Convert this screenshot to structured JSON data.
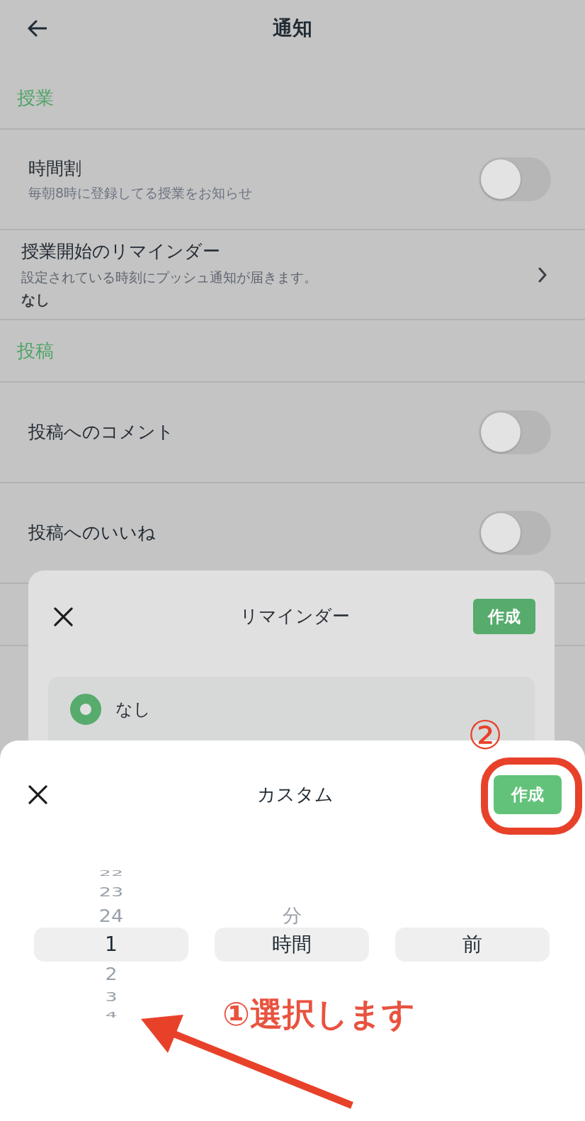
{
  "header": {
    "title": "通知"
  },
  "sections": [
    {
      "title": "授業",
      "rows": [
        {
          "kind": "toggle",
          "title": "時間割",
          "subtitle": "毎朝8時に登録してる授業をお知らせ",
          "on": false
        },
        {
          "kind": "link",
          "title": "授業開始のリマインダー",
          "subtitle": "設定されている時刻にプッシュ通知が届きます。",
          "value": "なし"
        }
      ]
    },
    {
      "title": "投稿",
      "rows": [
        {
          "kind": "toggle",
          "title": "投稿へのコメント",
          "on": false
        },
        {
          "kind": "toggle",
          "title": "投稿へのいいね",
          "on": false
        }
      ]
    }
  ],
  "reminder_dialog": {
    "title": "リマインダー",
    "action": "作成",
    "options": [
      {
        "label": "なし",
        "selected": true
      }
    ]
  },
  "custom_sheet": {
    "title": "カスタム",
    "action": "作成",
    "wheels": [
      {
        "items": [
          {
            "label": "22",
            "selected": false
          },
          {
            "label": "23",
            "selected": false
          },
          {
            "label": "24",
            "selected": false
          },
          {
            "label": "1",
            "selected": true
          },
          {
            "label": "2",
            "selected": false
          },
          {
            "label": "3",
            "selected": false
          },
          {
            "label": "4",
            "selected": false
          }
        ]
      },
      {
        "items": [
          {
            "label": "分",
            "selected": false
          },
          {
            "label": "時間",
            "selected": true
          }
        ]
      },
      {
        "items": [
          {
            "label": "前",
            "selected": true
          }
        ]
      }
    ]
  },
  "annotations": [
    {
      "kind": "step",
      "text": "②"
    },
    {
      "kind": "ring"
    },
    {
      "kind": "callout",
      "text": "①選択します"
    },
    {
      "kind": "arrow"
    }
  ]
}
